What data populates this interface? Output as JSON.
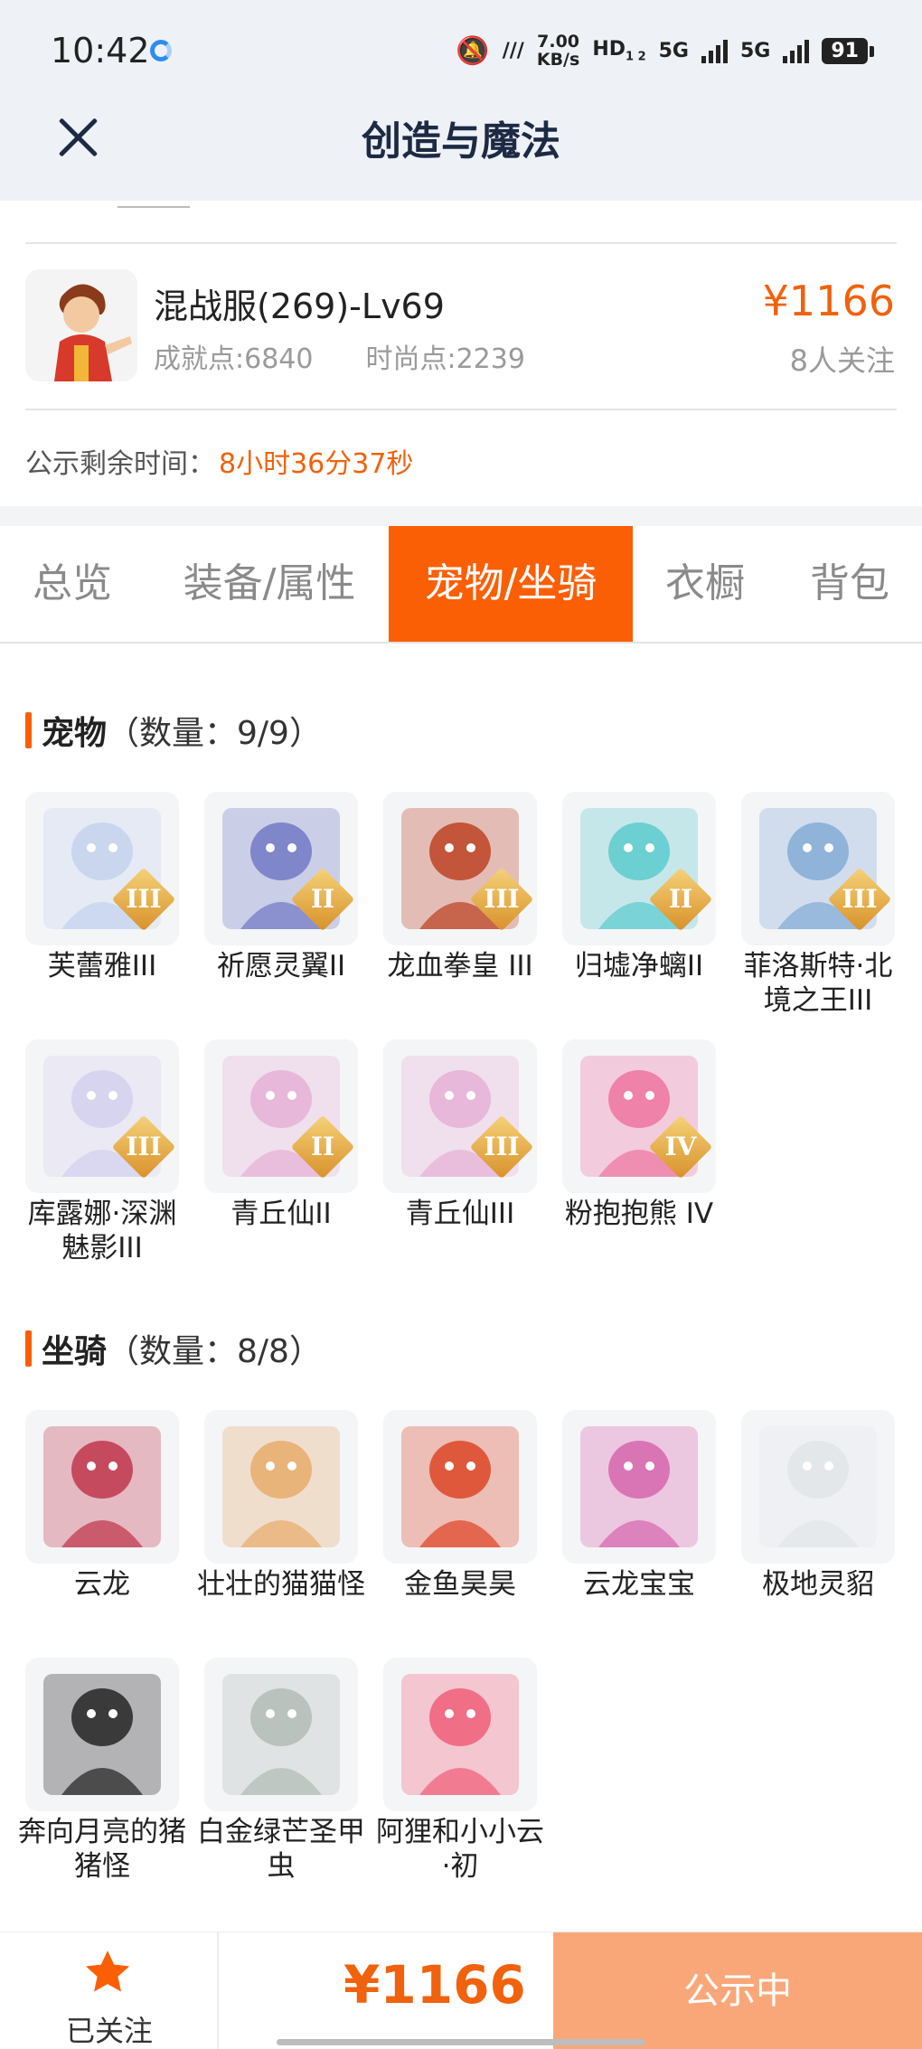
{
  "status_bar": {
    "time": "10:42",
    "net_speed_value": "7.00",
    "net_speed_unit": "KB/s",
    "hd": "HD",
    "hd_sub": "1 2",
    "sig1": "5G",
    "sig2": "5G",
    "battery": "91"
  },
  "nav": {
    "title": "创造与魔法"
  },
  "listing": {
    "server": "混战服(269)-Lv69",
    "achievement": "成就点:6840",
    "fashion": "时尚点:2239",
    "price": "¥1166",
    "followers": "8人关注",
    "countdown_label": "公示剩余时间：",
    "countdown_value": "8小时36分37秒"
  },
  "tabs": [
    {
      "label": "总览",
      "active": false
    },
    {
      "label": "装备/属性",
      "active": false
    },
    {
      "label": "宠物/坐骑",
      "active": true
    },
    {
      "label": "衣橱",
      "active": false
    },
    {
      "label": "背包",
      "active": false
    }
  ],
  "pets": {
    "title": "宠物",
    "count": "（数量：9/9）",
    "items": [
      {
        "name": "芙蕾雅III",
        "rank": "III",
        "color": "#c9d6ee"
      },
      {
        "name": "祈愿灵翼II",
        "rank": "II",
        "color": "#7f86c9"
      },
      {
        "name": "龙血拳皇 III",
        "rank": "III",
        "color": "#c2553a"
      },
      {
        "name": "归墟净螭II",
        "rank": "II",
        "color": "#6ccfd2"
      },
      {
        "name": "菲洛斯特·北境之王III",
        "rank": "III",
        "color": "#8fb3d9"
      },
      {
        "name": "库露娜·深渊魅影III",
        "rank": "III",
        "color": "#d7d4ef"
      },
      {
        "name": "青丘仙II",
        "rank": "II",
        "color": "#e7b8d9"
      },
      {
        "name": "青丘仙III",
        "rank": "III",
        "color": "#e7b8d9"
      },
      {
        "name": "粉抱抱熊 IV",
        "rank": "IV",
        "color": "#ef82a9"
      }
    ]
  },
  "mounts": {
    "title": "坐骑",
    "count": "（数量：8/8）",
    "items": [
      {
        "name": "云龙",
        "color": "#c64a5e"
      },
      {
        "name": "壮壮的猫猫怪",
        "color": "#e9b47a"
      },
      {
        "name": "金鱼昊昊",
        "color": "#e0583c"
      },
      {
        "name": "云龙宝宝",
        "color": "#d975b5"
      },
      {
        "name": "极地灵貂",
        "color": "#e4e7ea"
      },
      {
        "name": "奔向月亮的猪猪怪",
        "color": "#3a3a3a"
      },
      {
        "name": "白金绿芒圣甲虫",
        "color": "#b9c2bc"
      },
      {
        "name": "阿狸和小小云·初",
        "color": "#f06f86"
      }
    ]
  },
  "bottom_bar": {
    "follow_label": "已关注",
    "price": "¥1166",
    "status": "公示中"
  },
  "colors": {
    "accent": "#fb5f06",
    "price": "#f0620d",
    "status_btn": "#f9a779"
  }
}
